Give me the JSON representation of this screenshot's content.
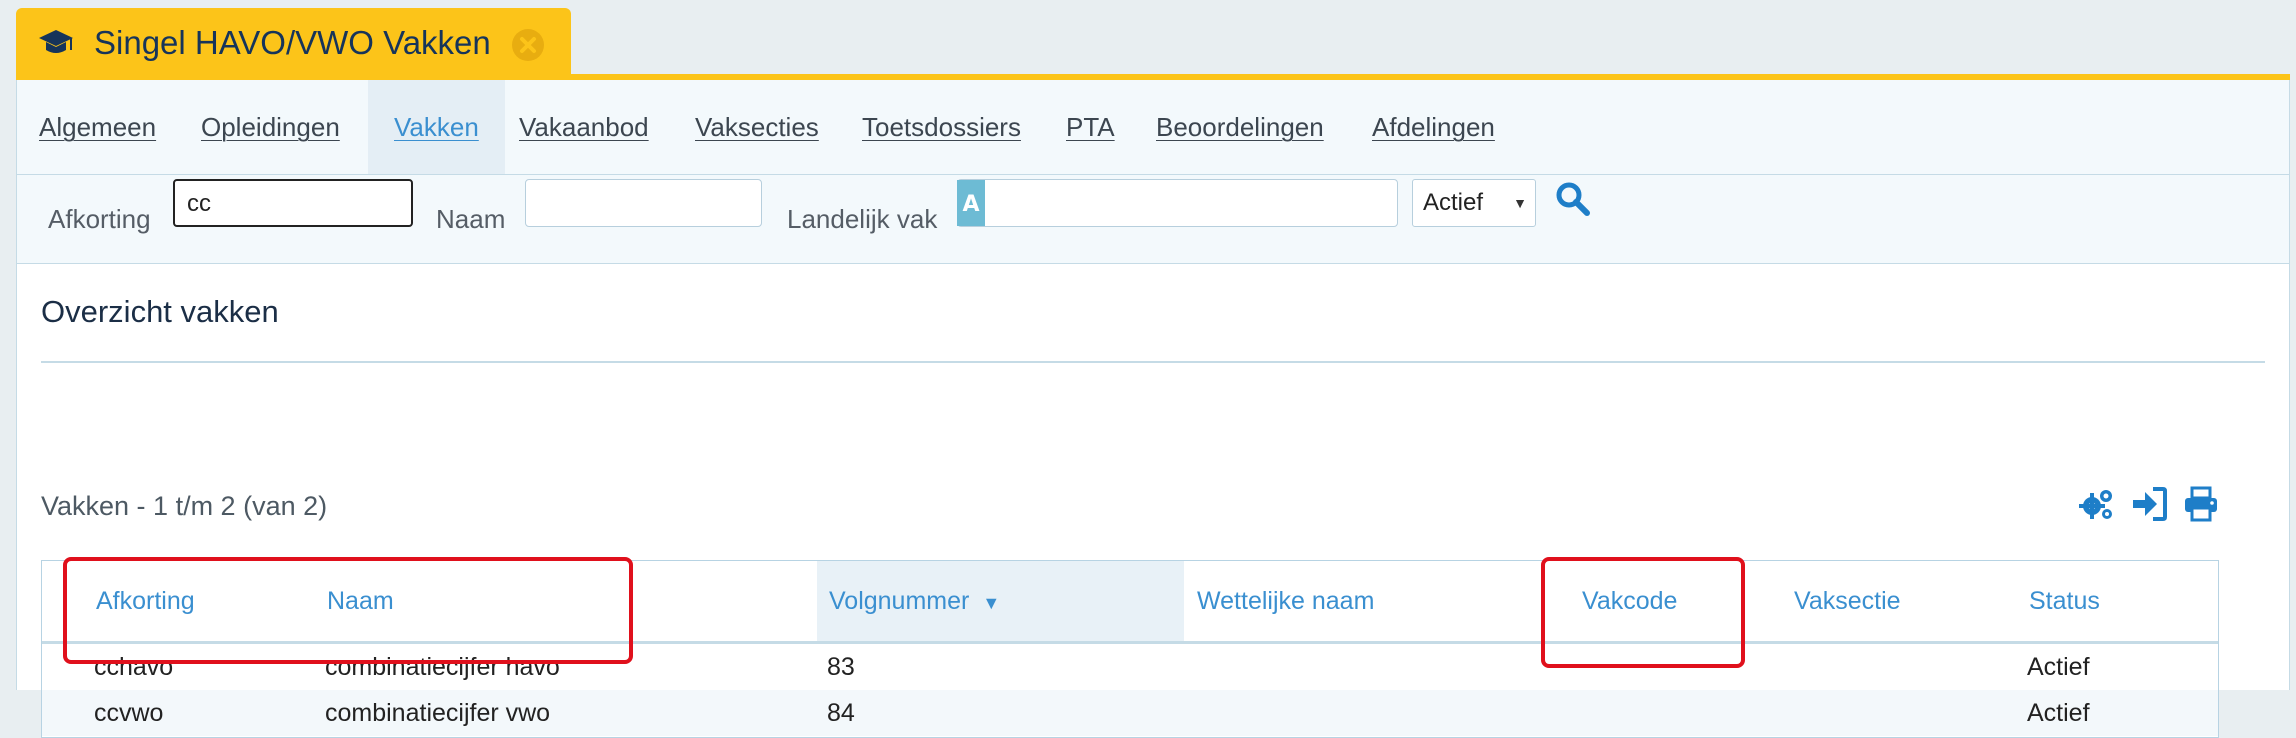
{
  "window_tab": {
    "title": "Singel HAVO/VWO Vakken",
    "icon": "graduation-cap-icon",
    "close_icon": "close-circle-icon"
  },
  "nav": {
    "items": [
      {
        "label": "Algemeen",
        "active": false
      },
      {
        "label": "Opleidingen",
        "active": false
      },
      {
        "label": "Vakken",
        "active": true
      },
      {
        "label": "Vakaanbod",
        "active": false
      },
      {
        "label": "Vaksecties",
        "active": false
      },
      {
        "label": "Toetsdossiers",
        "active": false
      },
      {
        "label": "PTA",
        "active": false
      },
      {
        "label": "Beoordelingen",
        "active": false
      },
      {
        "label": "Afdelingen",
        "active": false
      }
    ]
  },
  "filter": {
    "afkorting_label": "Afkorting",
    "afkorting_value": "cc",
    "naam_label": "Naam",
    "naam_value": "",
    "landelijk_label": "Landelijk vak",
    "landelijk_value": "",
    "status_select": "Actief",
    "search_icon": "search-icon"
  },
  "page_title": "Overzicht vakken",
  "list_title": "Vakken - 1 t/m 2 (van 2)",
  "toolbar_icons": [
    "settings-gears-icon",
    "export-sign-in-icon",
    "print-icon"
  ],
  "table": {
    "columns": [
      "Afkorting",
      "Naam",
      "Volgnummer",
      "Wettelijke naam",
      "Vakcode",
      "Vaksectie",
      "Status"
    ],
    "sorted_column": "Volgnummer",
    "sort_direction": "desc",
    "rows": [
      [
        "cchavo",
        "combinatiecijfer havo",
        "83",
        "",
        "",
        "",
        "Actief"
      ],
      [
        "ccvwo",
        "combinatiecijfer vwo",
        "84",
        "",
        "",
        "",
        "Actief"
      ]
    ]
  },
  "colors": {
    "accent_yellow": "#fcc419",
    "link_blue": "#3a8fd0",
    "highlight_red": "#e0101c"
  }
}
